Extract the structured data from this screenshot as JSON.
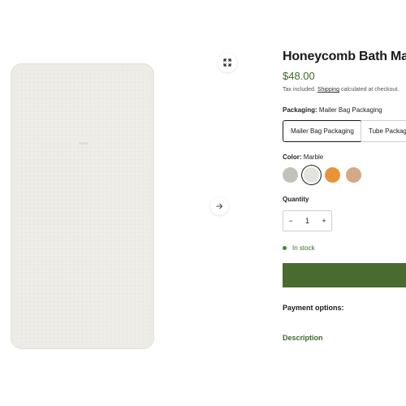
{
  "gallery": {
    "zoom_icon": "expand-icon",
    "next_icon": "arrow-right-icon"
  },
  "product": {
    "title": "Honeycomb Bath Mat",
    "price": "$48.00",
    "tax_prefix": "Tax included. ",
    "tax_link": "Shipping",
    "tax_suffix": " calculated at checkout."
  },
  "packaging": {
    "label": "Packaging:",
    "selected": "Mailer Bag Packaging",
    "options": [
      "Mailer Bag Packaging",
      "Tube Packaging"
    ]
  },
  "color": {
    "label": "Color:",
    "selected": "Marble",
    "swatches": [
      {
        "color": "#c2c2bd"
      },
      {
        "color": "#e3e4dc"
      },
      {
        "color": "#e8933a"
      },
      {
        "color": "#d4a985"
      }
    ]
  },
  "quantity": {
    "label": "Quantity",
    "value": "1",
    "minus": "−",
    "plus": "+"
  },
  "stock": {
    "text": "In stock"
  },
  "cart": {
    "label": ""
  },
  "payment": {
    "label": "Payment options:"
  },
  "description": {
    "label": "Description"
  },
  "colors": {
    "accent": "#4a6b30",
    "price": "#3d6a2b"
  }
}
